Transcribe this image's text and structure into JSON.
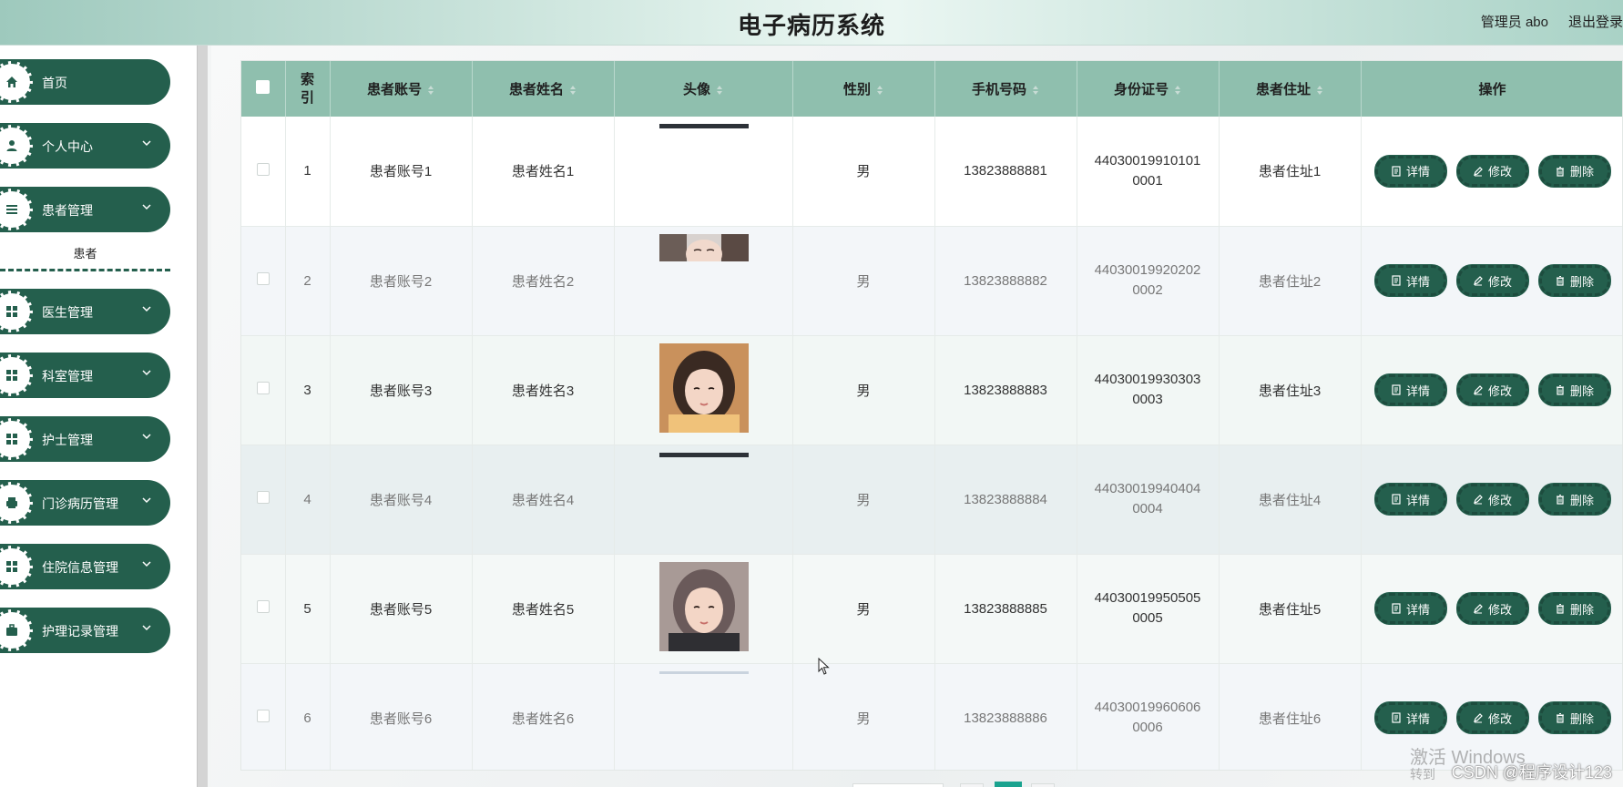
{
  "header": {
    "title": "电子病历系统",
    "user": "管理员 abo",
    "logout": "退出登录"
  },
  "sidebar": {
    "items": [
      {
        "label": "首页",
        "icon": "home-icon"
      },
      {
        "label": "个人中心",
        "icon": "user-icon"
      },
      {
        "label": "患者管理",
        "icon": "list-icon"
      },
      {
        "label": "医生管理",
        "icon": "grid-icon"
      },
      {
        "label": "科室管理",
        "icon": "grid-icon"
      },
      {
        "label": "护士管理",
        "icon": "grid-icon"
      },
      {
        "label": "门诊病历管理",
        "icon": "printer-icon"
      },
      {
        "label": "住院信息管理",
        "icon": "grid-icon"
      },
      {
        "label": "护理记录管理",
        "icon": "briefcase-icon"
      }
    ],
    "sub_item": "患者"
  },
  "table": {
    "headers": [
      "索引",
      "患者账号",
      "患者姓名",
      "头像",
      "性别",
      "手机号码",
      "身份证号",
      "患者住址",
      "操作"
    ],
    "rows": [
      {
        "index": "1",
        "account": "患者账号1",
        "name": "患者姓名1",
        "gender": "男",
        "phone": "13823888881",
        "id1": "44030019910101",
        "id2": "0001",
        "address": "患者住址1",
        "avatar": "photo-strip"
      },
      {
        "index": "2",
        "account": "患者账号2",
        "name": "患者姓名2",
        "gender": "男",
        "phone": "13823888882",
        "id1": "44030019920202",
        "id2": "0002",
        "address": "患者住址2",
        "avatar": "photo-partial"
      },
      {
        "index": "3",
        "account": "患者账号3",
        "name": "患者姓名3",
        "gender": "男",
        "phone": "13823888883",
        "id1": "44030019930303",
        "id2": "0003",
        "address": "患者住址3",
        "avatar": "photo-full"
      },
      {
        "index": "4",
        "account": "患者账号4",
        "name": "患者姓名4",
        "gender": "男",
        "phone": "13823888884",
        "id1": "44030019940404",
        "id2": "0004",
        "address": "患者住址4",
        "avatar": "photo-strip"
      },
      {
        "index": "5",
        "account": "患者账号5",
        "name": "患者姓名5",
        "gender": "男",
        "phone": "13823888885",
        "id1": "44030019950505",
        "id2": "0005",
        "address": "患者住址5",
        "avatar": "photo-full"
      },
      {
        "index": "6",
        "account": "患者账号6",
        "name": "患者姓名6",
        "gender": "男",
        "phone": "13823888886",
        "id1": "44030019960606",
        "id2": "0006",
        "address": "患者住址6",
        "avatar": "photo-strip-light"
      }
    ],
    "actions": {
      "detail": "详情",
      "edit": "修改",
      "delete": "删除"
    }
  },
  "overlay": {
    "activate_windows": "激活 Windows",
    "activate_hint": "转到",
    "csdn": "CSDN @程序设计123"
  },
  "colors": {
    "header_bg": "#8fbfae",
    "menu_bg": "#245f4d",
    "button_bg": "#245f4d"
  }
}
